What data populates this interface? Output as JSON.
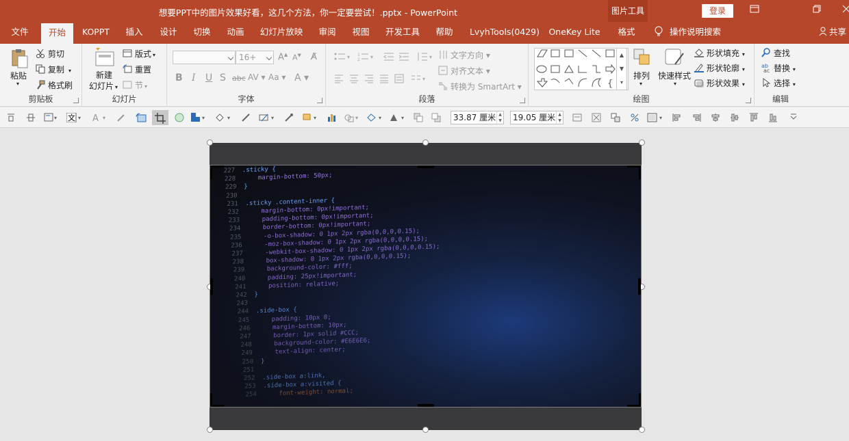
{
  "window": {
    "title": "想要PPT中的图片效果好看，这几个方法，你一定要尝试！.pptx - PowerPoint",
    "context_tab": "图片工具",
    "login": "登录"
  },
  "tabs": [
    "文件",
    "开始",
    "KOPPT",
    "插入",
    "设计",
    "切换",
    "动画",
    "幻灯片放映",
    "审阅",
    "视图",
    "开发工具",
    "帮助",
    "LvyhTools(0429)",
    "OneKey Lite",
    "格式"
  ],
  "tab_search": "操作说明搜索",
  "tab_share": "共享",
  "ribbon": {
    "clipboard": {
      "label": "剪贴板",
      "paste": "粘贴",
      "cut": "剪切",
      "copy": "复制",
      "format_painter": "格式刷"
    },
    "slides": {
      "label": "幻灯片",
      "new_slide_1": "新建",
      "new_slide_2": "幻灯片",
      "layout": "版式",
      "reset": "重置",
      "section": "节"
    },
    "font": {
      "label": "字体",
      "size": "16+"
    },
    "paragraph": {
      "label": "段落",
      "text_direction": "文字方向",
      "align_text": "对齐文本",
      "smartart": "转换为 SmartArt"
    },
    "drawing": {
      "label": "绘图",
      "arrange": "排列",
      "quick_styles": "快速样式",
      "shape_fill": "形状填充",
      "shape_outline": "形状轮廓",
      "shape_effects": "形状效果"
    },
    "editing": {
      "label": "编辑",
      "find": "查找",
      "replace": "替换",
      "select": "选择"
    }
  },
  "quick_access": {
    "width": "33.87 厘米",
    "height": "19.05 厘米"
  },
  "code_lines": [
    {
      "n": "227",
      "t": ".sticky {",
      "c": "#6ea8ff"
    },
    {
      "n": "228",
      "t": "    margin-bottom: 50px;",
      "c": "#9f7aea"
    },
    {
      "n": "229",
      "t": "}",
      "c": "#6ea8ff"
    },
    {
      "n": "230",
      "t": "",
      "c": "#6ea8ff"
    },
    {
      "n": "231",
      "t": ".sticky .content-inner {",
      "c": "#6ea8ff"
    },
    {
      "n": "232",
      "t": "    margin-bottom: 0px!important;",
      "c": "#9f7aea"
    },
    {
      "n": "233",
      "t": "    padding-bottom: 0px!important;",
      "c": "#9f7aea"
    },
    {
      "n": "234",
      "t": "    border-bottom: 0px!important;",
      "c": "#9f7aea"
    },
    {
      "n": "235",
      "t": "    -o-box-shadow: 0 1px 2px rgba(0,0,0,0.15);",
      "c": "#9f7aea"
    },
    {
      "n": "236",
      "t": "    -moz-box-shadow: 0 1px 2px rgba(0,0,0,0.15);",
      "c": "#9f7aea"
    },
    {
      "n": "237",
      "t": "    -webkit-box-shadow: 0 1px 2px rgba(0,0,0,0.15);",
      "c": "#9f7aea"
    },
    {
      "n": "238",
      "t": "    box-shadow: 0 1px 2px rgba(0,0,0,0.15);",
      "c": "#9f7aea"
    },
    {
      "n": "239",
      "t": "    background-color: #fff;",
      "c": "#9f7aea"
    },
    {
      "n": "240",
      "t": "    padding: 25px!important;",
      "c": "#9f7aea"
    },
    {
      "n": "241",
      "t": "    position: relative;",
      "c": "#9f7aea"
    },
    {
      "n": "242",
      "t": "}",
      "c": "#6ea8ff"
    },
    {
      "n": "243",
      "t": "",
      "c": "#6ea8ff"
    },
    {
      "n": "244",
      "t": ".side-box {",
      "c": "#6ea8ff"
    },
    {
      "n": "245",
      "t": "    padding: 10px 0;",
      "c": "#9f7aea"
    },
    {
      "n": "246",
      "t": "    margin-bottom: 10px;",
      "c": "#9f7aea"
    },
    {
      "n": "247",
      "t": "    border: 1px solid #CCC;",
      "c": "#9f7aea"
    },
    {
      "n": "248",
      "t": "    background-color: #E6E6E6;",
      "c": "#9f7aea"
    },
    {
      "n": "249",
      "t": "    text-align: center;",
      "c": "#9f7aea"
    },
    {
      "n": "250",
      "t": "}",
      "c": "#6ea8ff"
    },
    {
      "n": "251",
      "t": "",
      "c": "#6ea8ff"
    },
    {
      "n": "252",
      "t": ".side-box a:link,",
      "c": "#6ea8ff"
    },
    {
      "n": "253",
      "t": ".side-box a:visited {",
      "c": "#6ea8ff"
    },
    {
      "n": "254",
      "t": "    font-weight: normal;",
      "c": "#c2703d"
    }
  ],
  "colors": {
    "accent": "#b7472a",
    "ribbon_bg": "#f3f3f3",
    "canvas_bg": "#e6e6e6"
  }
}
